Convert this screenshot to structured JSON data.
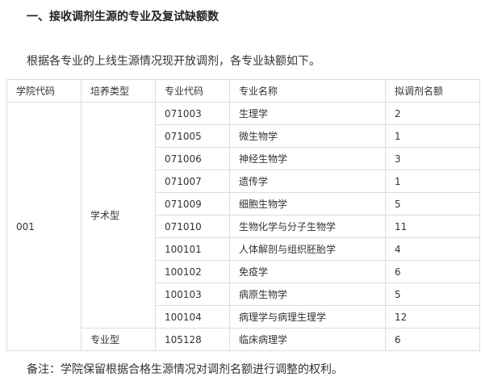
{
  "heading": "一、接收调剂生源的专业及复试缺额数",
  "intro": "根据各专业的上线生源情况现开放调剂，各专业缺额如下。",
  "table": {
    "headers": [
      "学院代码",
      "培养类型",
      "专业代码",
      "专业名称",
      "拟调剂名额"
    ],
    "college_code": "001",
    "academic_type": "学术型",
    "professional_type": "专业型",
    "rows": [
      {
        "code": "071003",
        "name": "生理学",
        "quota": "2"
      },
      {
        "code": "071005",
        "name": "微生物学",
        "quota": "1"
      },
      {
        "code": "071006",
        "name": "神经生物学",
        "quota": "3"
      },
      {
        "code": "071007",
        "name": "遗传学",
        "quota": "1"
      },
      {
        "code": "071009",
        "name": "细胞生物学",
        "quota": "5"
      },
      {
        "code": "071010",
        "name": "生物化学与分子生物学",
        "quota": "11"
      },
      {
        "code": "100101",
        "name": "人体解剖与组织胚胎学",
        "quota": "4"
      },
      {
        "code": "100102",
        "name": "免疫学",
        "quota": "6"
      },
      {
        "code": "100103",
        "name": "病原生物学",
        "quota": "5"
      },
      {
        "code": "100104",
        "name": "病理学与病理生理学",
        "quota": "12"
      },
      {
        "code": "105128",
        "name": "临床病理学",
        "quota": "6"
      }
    ]
  },
  "note": "备注：学院保留根据合格生源情况对调剂名额进行调整的权利。"
}
